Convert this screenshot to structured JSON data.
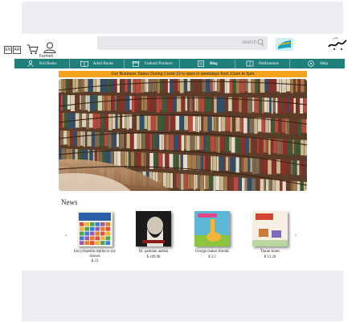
{
  "header": {
    "lang_buttons": [
      "EN",
      "AR"
    ],
    "user_label": "Farmeh",
    "search_placeholder": "search",
    "logo_text": "پاپ نشر"
  },
  "nav": {
    "items": [
      {
        "label": "Kid Books",
        "icon": "kid-icon"
      },
      {
        "label": "Adult Books",
        "icon": "open-book-icon"
      },
      {
        "label": "Cultural Products",
        "icon": "gift-icon"
      },
      {
        "label": "Blog",
        "icon": "blog-icon",
        "active": true
      },
      {
        "label": "Publications",
        "icon": "publication-icon"
      },
      {
        "label": "Help",
        "icon": "help-icon"
      }
    ]
  },
  "status_banner": "Our Business Status During Covid-19 is open in weekdays from 10am to 5pm",
  "news": {
    "title": "News",
    "prev": "‹",
    "next": "›",
    "items": [
      {
        "name": "Encyclopedia replies to my shoves",
        "price": "$ 23"
      },
      {
        "name": "Dr. paimian andish",
        "price": "$ 109.90"
      },
      {
        "name": "George makes friends",
        "price": "$ 3.5"
      },
      {
        "name": "Tiarae shoes",
        "price": "$ 13.20"
      }
    ]
  },
  "colors": {
    "nav": "#1f7f7b",
    "status": "#f2a31b",
    "band": "#eceef1"
  }
}
